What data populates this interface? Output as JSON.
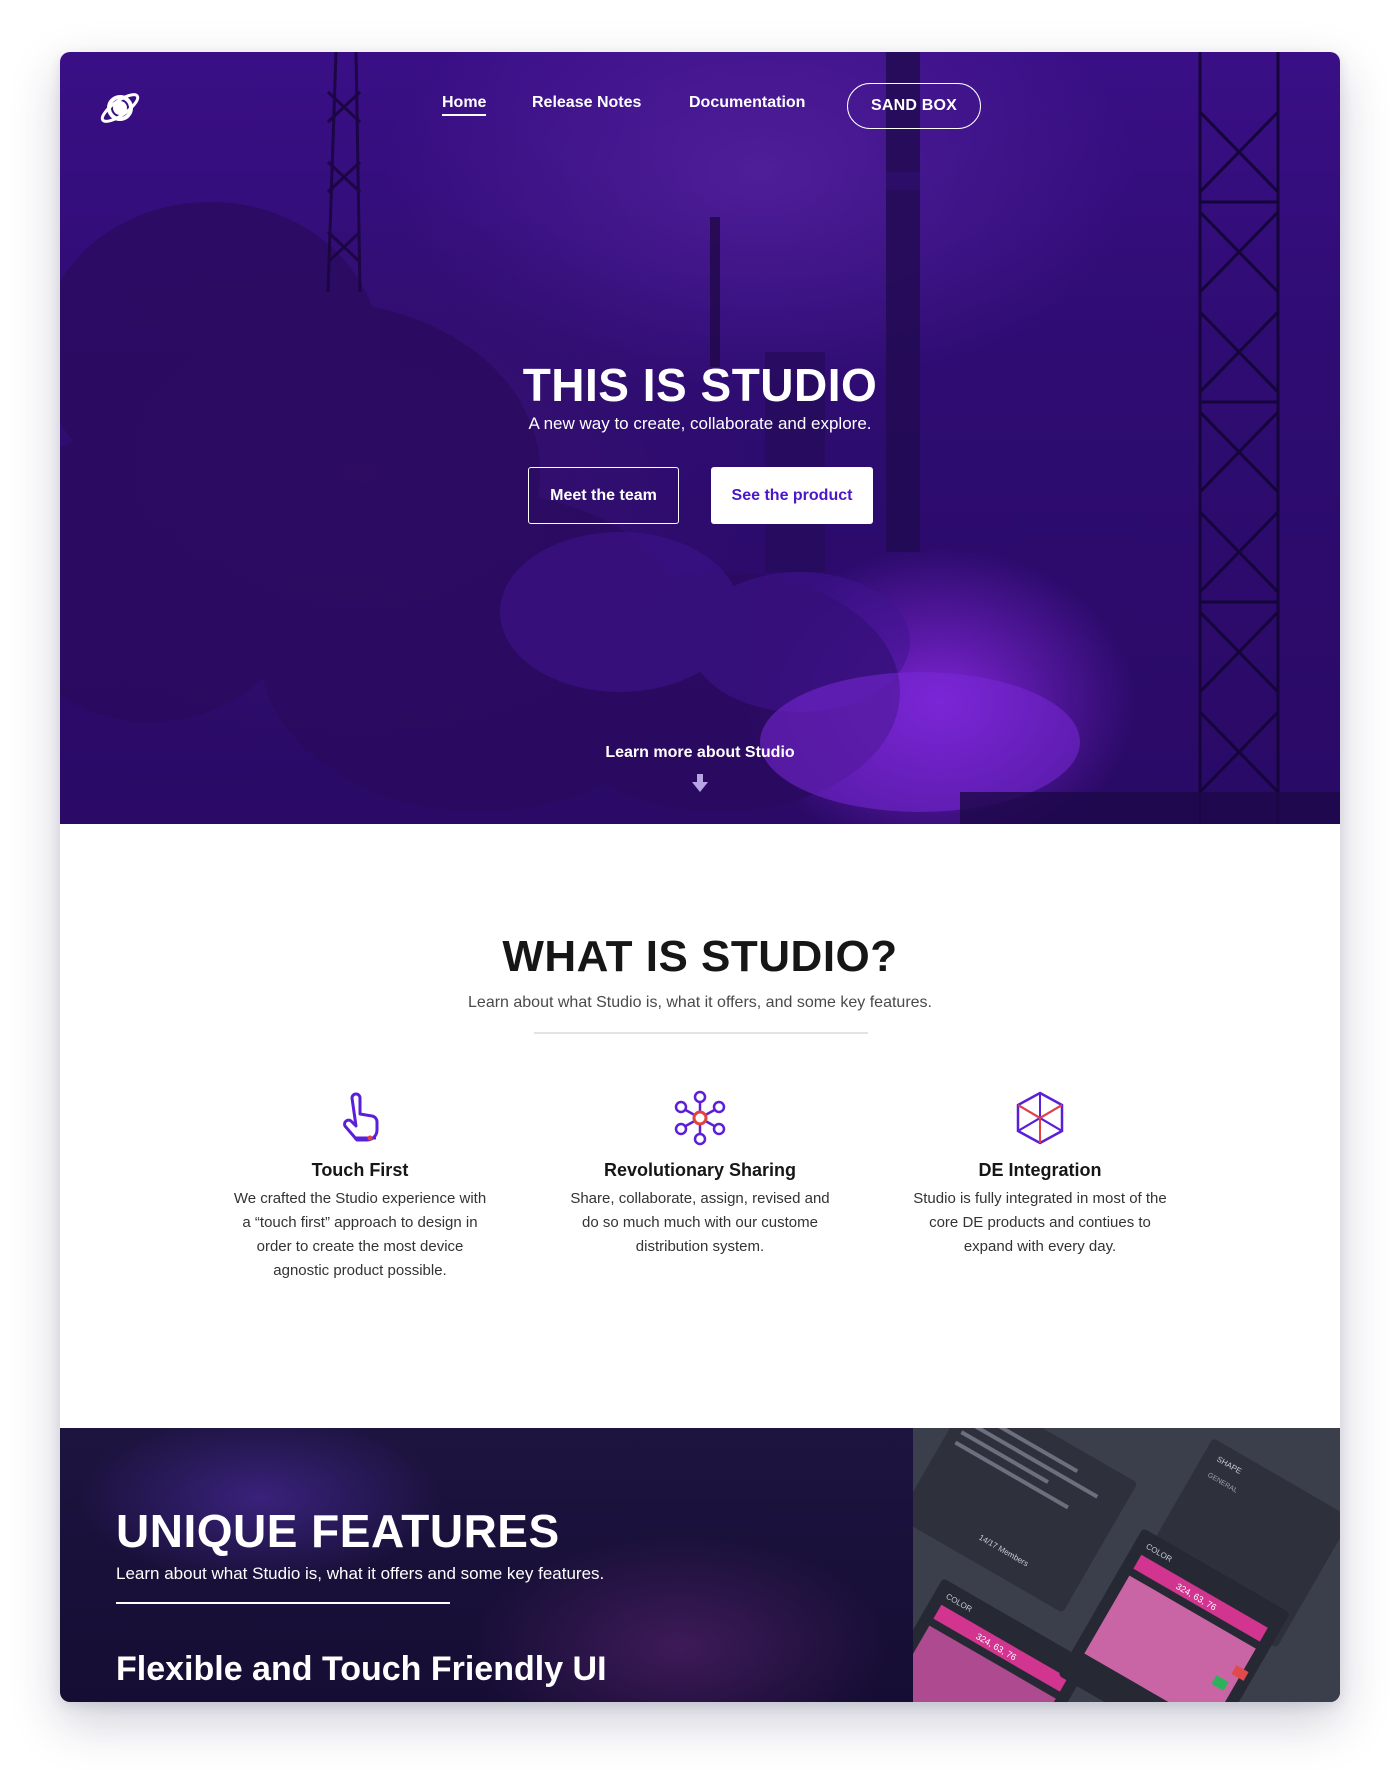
{
  "nav": {
    "logo_icon": "planet-icon",
    "links": [
      {
        "label": "Home",
        "active": true
      },
      {
        "label": "Release Notes",
        "active": false
      },
      {
        "label": "Documentation",
        "active": false
      }
    ],
    "cta_label": "SAND BOX"
  },
  "hero": {
    "title": "THIS IS STUDIO",
    "subtitle": "A new way to create, collaborate and explore.",
    "primary_button": "Meet the team",
    "secondary_button": "See the product",
    "learn_more": "Learn more about Studio",
    "scroll_icon": "arrow-down-icon"
  },
  "what": {
    "title": "WHAT IS STUDIO?",
    "subtitle": "Learn about what Studio is, what it offers, and some key features.",
    "features": [
      {
        "icon": "touch-hand-icon",
        "title": "Touch First",
        "desc": "We crafted the Studio experience with a “touch first” approach to design in order to create the most device agnostic product possible."
      },
      {
        "icon": "network-share-icon",
        "title": "Revolutionary Sharing",
        "desc": "Share, collaborate, assign, revised and do so much much with our custome distribution system."
      },
      {
        "icon": "cube-icon",
        "title": "DE Integration",
        "desc": "Studio is fully integrated in most of the core DE products and contiues to expand with every day."
      }
    ]
  },
  "unique": {
    "title": "UNIQUE FEATURES",
    "subtitle": "Learn about what Studio is, what it offers and some key features.",
    "heading": "Flexible and Touch Friendly UI",
    "mockup": {
      "panel_color": "COLOR",
      "value": "324, 63, 76",
      "members": "14/17 Members",
      "panel_shape": "SHAPE",
      "general": "GENERAL"
    }
  },
  "colors": {
    "hero_purple": "#3a0f86",
    "accent_purple": "#4b17c9",
    "icon_purple": "#5a1fd6",
    "icon_accent_red": "#e2433f",
    "dark_section": "#1d1440",
    "mockup_pink": "#d2358f"
  }
}
